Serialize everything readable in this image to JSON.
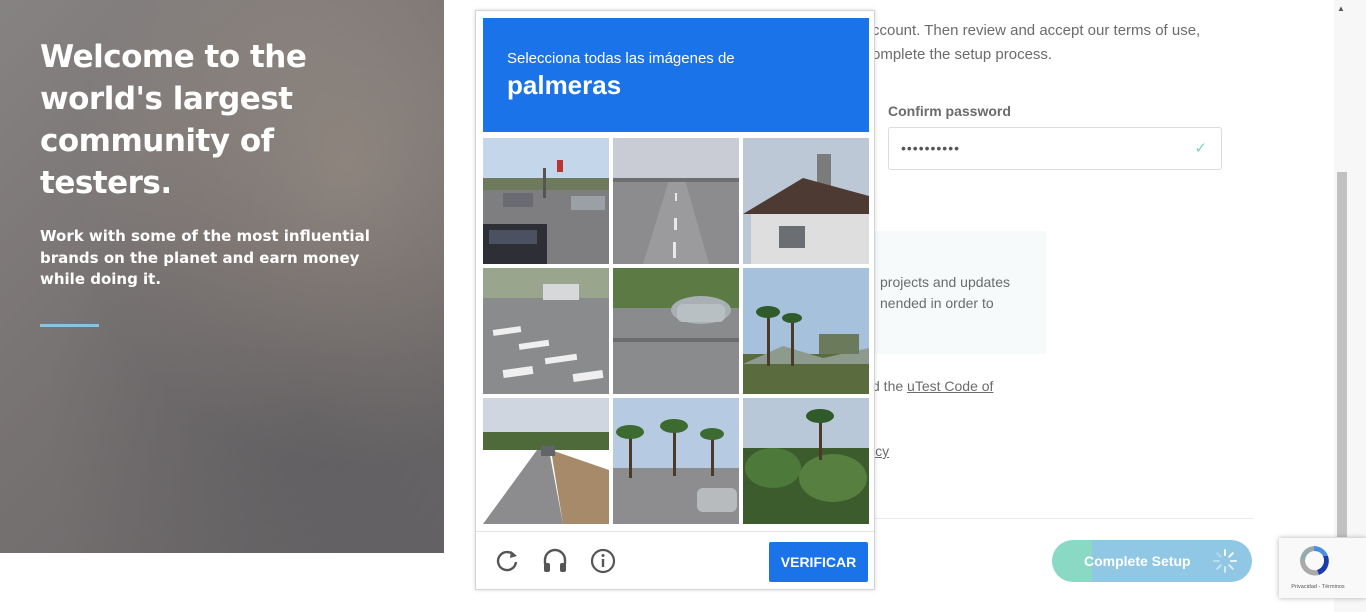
{
  "hero": {
    "title_line1": "Welcome to the",
    "title_line2": "world's largest",
    "title_line3": "community of testers.",
    "subtitle": "Work with some of the most influential brands on the planet and earn money while doing it."
  },
  "form": {
    "intro_line1": "ccount. Then review and accept our terms of use,",
    "intro_line2": "omplete the setup process.",
    "confirm_password_label": "Confirm password",
    "confirm_password_value": "••••••••••",
    "info_line1": "projects and updates",
    "info_line2": "nended in order to",
    "code_prefix": "d the ",
    "code_link": "uTest Code of",
    "policy_fragment": "icy",
    "complete_button": "Complete Setup"
  },
  "captcha": {
    "instruction": "Selecciona todas las imágenes de",
    "target": "palmeras",
    "verify_button": "VERIFICAR",
    "icons": [
      "reload-icon",
      "headphones-icon",
      "info-icon"
    ]
  },
  "badge": {
    "links": "Privacidad - Términos"
  },
  "colors": {
    "captcha_blue": "#1a73e8",
    "complete_green": "#8ad9c4",
    "complete_blue": "#8fc7e4"
  }
}
